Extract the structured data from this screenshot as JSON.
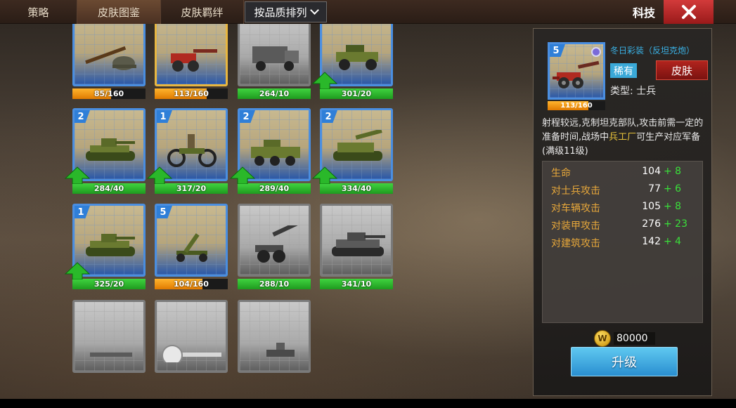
{
  "nav": {
    "tabs": [
      "策略",
      "皮肤图鉴",
      "皮肤羁绊"
    ],
    "sort_label": "按品质排列",
    "tech_label": "科技",
    "close_icon": "close-icon"
  },
  "cards": [
    {
      "level": "",
      "progress": "85/160",
      "fill": 0.53,
      "color": "orange",
      "style": "blue",
      "unit": "rifle",
      "arrow": false
    },
    {
      "level": "",
      "progress": "113/160",
      "fill": 0.71,
      "color": "orange",
      "style": "gold",
      "unit": "artillery",
      "arrow": false
    },
    {
      "level": "",
      "progress": "264/10",
      "fill": 1,
      "color": "green",
      "style": "gray",
      "unit": "truck",
      "arrow": false
    },
    {
      "level": "",
      "progress": "301/20",
      "fill": 1,
      "color": "green",
      "style": "blue",
      "unit": "jeep",
      "arrow": true
    },
    {
      "level": "2",
      "progress": "284/40",
      "fill": 1,
      "color": "green",
      "style": "blue",
      "unit": "tank",
      "arrow": true
    },
    {
      "level": "1",
      "progress": "317/20",
      "fill": 1,
      "color": "green",
      "style": "blue",
      "unit": "motorcycle",
      "arrow": true
    },
    {
      "level": "2",
      "progress": "289/40",
      "fill": 1,
      "color": "green",
      "style": "blue",
      "unit": "apc",
      "arrow": true
    },
    {
      "level": "2",
      "progress": "334/40",
      "fill": 1,
      "color": "green",
      "style": "blue",
      "unit": "spg",
      "arrow": true
    },
    {
      "level": "1",
      "progress": "325/20",
      "fill": 1,
      "color": "green",
      "style": "blue",
      "unit": "tank",
      "arrow": true
    },
    {
      "level": "5",
      "progress": "104/160",
      "fill": 0.65,
      "color": "orange",
      "style": "blue",
      "unit": "aa-gun",
      "arrow": false
    },
    {
      "level": "",
      "progress": "288/10",
      "fill": 1,
      "color": "green",
      "style": "gray",
      "unit": "howitzer",
      "arrow": false
    },
    {
      "level": "",
      "progress": "341/10",
      "fill": 1,
      "color": "green",
      "style": "gray",
      "unit": "heavy-tank",
      "arrow": false
    },
    {
      "level": "",
      "progress": "",
      "fill": 0,
      "color": "green",
      "style": "gray",
      "unit": "partial",
      "arrow": false
    },
    {
      "level": "",
      "progress": "",
      "fill": 0,
      "color": "green",
      "style": "gray",
      "unit": "plane",
      "arrow": false
    },
    {
      "level": "",
      "progress": "",
      "fill": 0,
      "color": "green",
      "style": "gray",
      "unit": "ship",
      "arrow": false
    }
  ],
  "detail": {
    "level": "5",
    "skin_name": "冬日彩装（反坦克炮）",
    "progress": "113/160",
    "progress_fill": 0.71,
    "rarity": "稀有",
    "skin_button": "皮肤",
    "type_label": "类型: 士兵",
    "desc_pre": "射程较远,克制坦克部队,攻击前需一定的准备时间,战场中",
    "desc_hl": "兵工厂",
    "desc_post": "可生产对应军备(满级11级)",
    "stats": [
      {
        "label": "生命",
        "value": "104",
        "bonus": "+ 8"
      },
      {
        "label": "对士兵攻击",
        "value": "77",
        "bonus": "+ 6"
      },
      {
        "label": "对车辆攻击",
        "value": "105",
        "bonus": "+ 8"
      },
      {
        "label": "对装甲攻击",
        "value": "276",
        "bonus": "+ 23"
      },
      {
        "label": "对建筑攻击",
        "value": "142",
        "bonus": "+ 4"
      }
    ],
    "coin_icon": "W",
    "cost": "80000",
    "upgrade_label": "升级"
  }
}
